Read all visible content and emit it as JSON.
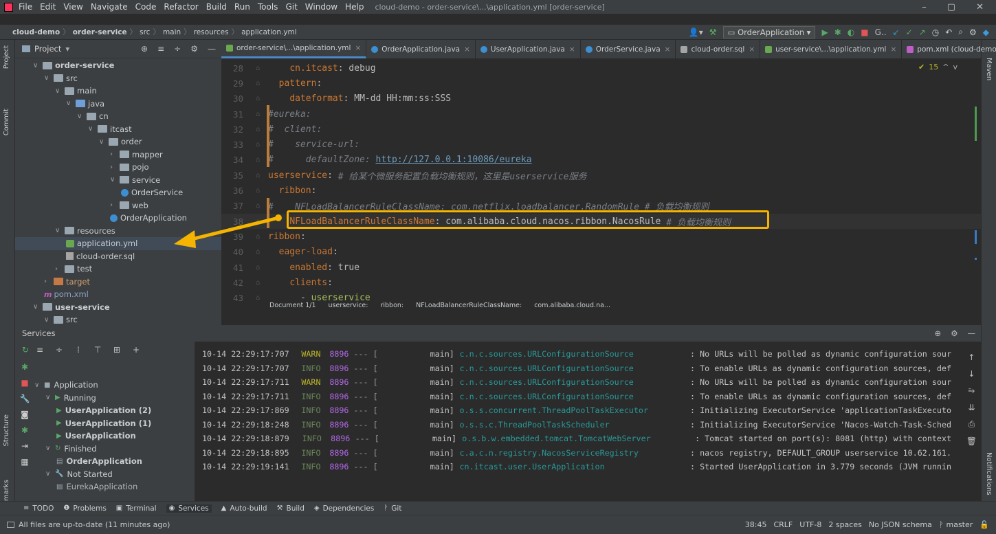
{
  "menu": {
    "items": [
      "File",
      "Edit",
      "View",
      "Navigate",
      "Code",
      "Refactor",
      "Build",
      "Run",
      "Tools",
      "Git",
      "Window",
      "Help"
    ],
    "title": "cloud-demo - order-service\\...\\application.yml [order-service]"
  },
  "breadcrumb": [
    "cloud-demo",
    "order-service",
    "src",
    "main",
    "resources",
    "application.yml"
  ],
  "run_config": "OrderApplication",
  "project_panel": {
    "title": "Project",
    "tree": [
      {
        "label": "order-service",
        "indent": 0,
        "kind": "module"
      },
      {
        "label": "src",
        "indent": 1,
        "kind": "folder"
      },
      {
        "label": "main",
        "indent": 2,
        "kind": "folder"
      },
      {
        "label": "java",
        "indent": 3,
        "kind": "blue"
      },
      {
        "label": "cn",
        "indent": 4,
        "kind": "pkg"
      },
      {
        "label": "itcast",
        "indent": 5,
        "kind": "pkg"
      },
      {
        "label": "order",
        "indent": 6,
        "kind": "pkg"
      },
      {
        "label": "mapper",
        "indent": 7,
        "kind": "pkg"
      },
      {
        "label": "pojo",
        "indent": 7,
        "kind": "pkg"
      },
      {
        "label": "service",
        "indent": 7,
        "kind": "pkg"
      },
      {
        "label": "OrderService",
        "indent": 8,
        "kind": "class"
      },
      {
        "label": "web",
        "indent": 7,
        "kind": "pkg"
      },
      {
        "label": "OrderApplication",
        "indent": 7,
        "kind": "class"
      },
      {
        "label": "resources",
        "indent": 2,
        "kind": "folder"
      },
      {
        "label": "application.yml",
        "indent": 3,
        "kind": "yml"
      },
      {
        "label": "cloud-order.sql",
        "indent": 3,
        "kind": "sql"
      },
      {
        "label": "test",
        "indent": 2,
        "kind": "folder"
      },
      {
        "label": "target",
        "indent": 1,
        "kind": "orange"
      },
      {
        "label": "pom.xml",
        "indent": 1,
        "kind": "pom"
      },
      {
        "label": "user-service",
        "indent": 0,
        "kind": "module"
      },
      {
        "label": "src",
        "indent": 1,
        "kind": "folder"
      }
    ]
  },
  "tabs": [
    "order-service\\...\\application.yml",
    "OrderApplication.java",
    "UserApplication.java",
    "OrderService.java",
    "cloud-order.sql",
    "user-service\\...\\application.yml",
    "pom.xml (cloud-demo)"
  ],
  "editor": {
    "warn_count": "15",
    "lines": [
      {
        "n": "28",
        "parts": [
          [
            "    ",
            ""
          ],
          [
            "cn.itcast",
            "key"
          ],
          [
            ": debug",
            ""
          ]
        ]
      },
      {
        "n": "29",
        "parts": [
          [
            "  ",
            ""
          ],
          [
            "pattern",
            "key"
          ],
          [
            ":",
            ""
          ]
        ]
      },
      {
        "n": "30",
        "parts": [
          [
            "    ",
            ""
          ],
          [
            "dateformat",
            "key"
          ],
          [
            ": MM-dd HH:mm:ss:SSS",
            ""
          ]
        ]
      },
      {
        "n": "31",
        "parts": [
          [
            "#eureka:",
            "com"
          ]
        ]
      },
      {
        "n": "32",
        "parts": [
          [
            "#  client:",
            "com"
          ]
        ]
      },
      {
        "n": "33",
        "parts": [
          [
            "#    service-url:",
            "com"
          ]
        ]
      },
      {
        "n": "34",
        "parts": [
          [
            "#      defaultZone: ",
            "com"
          ],
          [
            "http://127.0.0.1:10086/eureka",
            "lnk"
          ]
        ]
      },
      {
        "n": "35",
        "parts": [
          [
            "userservice",
            "key"
          ],
          [
            ": ",
            ""
          ],
          [
            "# 给某个微服务配置负载均衡规则，这里是userservice服务",
            "com"
          ]
        ]
      },
      {
        "n": "36",
        "parts": [
          [
            "  ",
            ""
          ],
          [
            "ribbon",
            "key"
          ],
          [
            ":",
            ""
          ]
        ]
      },
      {
        "n": "37",
        "parts": [
          [
            "#    NFLoadBalancerRuleClassName: com.netflix.loadbalancer.RandomRule # 负载均衡规则",
            "com"
          ]
        ]
      },
      {
        "n": "38",
        "parts": [
          [
            "    ",
            ""
          ],
          [
            "NFLoadBalancerRuleClassName",
            "key"
          ],
          [
            ": com.alibaba.cloud.nacos.ribbon.NacosRule ",
            ""
          ],
          [
            "# 负载均衡规则",
            "com"
          ]
        ]
      },
      {
        "n": "39",
        "parts": [
          [
            "ribbon",
            "key"
          ],
          [
            ":",
            ""
          ]
        ]
      },
      {
        "n": "40",
        "parts": [
          [
            "  ",
            ""
          ],
          [
            "eager-load",
            "key"
          ],
          [
            ":",
            ""
          ]
        ]
      },
      {
        "n": "41",
        "parts": [
          [
            "    ",
            ""
          ],
          [
            "enabled",
            "key"
          ],
          [
            ": true",
            ""
          ]
        ]
      },
      {
        "n": "42",
        "parts": [
          [
            "    ",
            ""
          ],
          [
            "clients",
            "key"
          ],
          [
            ":",
            ""
          ]
        ]
      },
      {
        "n": "43",
        "parts": [
          [
            "      - ",
            ""
          ],
          [
            "userservice",
            "str"
          ]
        ]
      }
    ],
    "status_path": [
      "Document 1/1",
      "userservice:",
      "ribbon:",
      "NFLoadBalancerRuleClassName:",
      "com.alibaba.cloud.na..."
    ]
  },
  "services": {
    "title": "Services",
    "tree": [
      {
        "label": "Application",
        "indent": 1,
        "bold": false
      },
      {
        "label": "Running",
        "indent": 2,
        "bold": false
      },
      {
        "label": "UserApplication (2)",
        "indent": 3,
        "bold": true
      },
      {
        "label": "UserApplication (1)",
        "indent": 3,
        "bold": true
      },
      {
        "label": "UserApplication",
        "indent": 3,
        "bold": true
      },
      {
        "label": "Finished",
        "indent": 2,
        "bold": false
      },
      {
        "label": "OrderApplication",
        "indent": 3,
        "bold": true
      },
      {
        "label": "Not Started",
        "indent": 2,
        "bold": false
      },
      {
        "label": "EurekaApplication",
        "indent": 3,
        "bold": false
      }
    ],
    "log": [
      {
        "time": "10-14 22:29:17:707",
        "lvl": "WARN",
        "pid": "8896",
        "sep": "--- [",
        "thread": "main]",
        "logger": "c.n.c.sources.URLConfigurationSource",
        "msg": ": No URLs will be polled as dynamic configuration sour"
      },
      {
        "time": "10-14 22:29:17:707",
        "lvl": "INFO",
        "pid": "8896",
        "sep": "--- [",
        "thread": "main]",
        "logger": "c.n.c.sources.URLConfigurationSource",
        "msg": ": To enable URLs as dynamic configuration sources, def"
      },
      {
        "time": "10-14 22:29:17:711",
        "lvl": "WARN",
        "pid": "8896",
        "sep": "--- [",
        "thread": "main]",
        "logger": "c.n.c.sources.URLConfigurationSource",
        "msg": ": No URLs will be polled as dynamic configuration sour"
      },
      {
        "time": "10-14 22:29:17:711",
        "lvl": "INFO",
        "pid": "8896",
        "sep": "--- [",
        "thread": "main]",
        "logger": "c.n.c.sources.URLConfigurationSource",
        "msg": ": To enable URLs as dynamic configuration sources, def"
      },
      {
        "time": "10-14 22:29:17:869",
        "lvl": "INFO",
        "pid": "8896",
        "sep": "--- [",
        "thread": "main]",
        "logger": "o.s.s.concurrent.ThreadPoolTaskExecutor",
        "msg": ": Initializing ExecutorService 'applicationTaskExecuto"
      },
      {
        "time": "10-14 22:29:18:248",
        "lvl": "INFO",
        "pid": "8896",
        "sep": "--- [",
        "thread": "main]",
        "logger": "o.s.s.c.ThreadPoolTaskScheduler",
        "msg": ": Initializing ExecutorService 'Nacos-Watch-Task-Sched"
      },
      {
        "time": "10-14 22:29:18:879",
        "lvl": "INFO",
        "pid": "8896",
        "sep": "--- [",
        "thread": "main]",
        "logger": "o.s.b.w.embedded.tomcat.TomcatWebServer",
        "msg": ": Tomcat started on port(s): 8081 (http) with context"
      },
      {
        "time": "10-14 22:29:18:895",
        "lvl": "INFO",
        "pid": "8896",
        "sep": "--- [",
        "thread": "main]",
        "logger": "c.a.c.n.registry.NacosServiceRegistry",
        "msg": ": nacos registry, DEFAULT_GROUP userservice 10.62.161."
      },
      {
        "time": "10-14 22:29:19:141",
        "lvl": "INFO",
        "pid": "8896",
        "sep": "--- [",
        "thread": "main]",
        "logger": "cn.itcast.user.UserApplication",
        "msg": ": Started UserApplication in 3.779 seconds (JVM runnin"
      }
    ]
  },
  "toolwindows": [
    "TODO",
    "Problems",
    "Terminal",
    "Services",
    "Auto-build",
    "Build",
    "Dependencies",
    "Git"
  ],
  "left_strip": [
    "Project",
    "Commit",
    "Structure",
    "Bookmarks"
  ],
  "right_strip": [
    "Maven",
    "Notifications"
  ],
  "status": {
    "left": "All files are up-to-date (11 minutes ago)",
    "right": [
      "38:45",
      "CRLF",
      "UTF-8",
      "2 spaces",
      "No JSON schema",
      "master"
    ]
  }
}
